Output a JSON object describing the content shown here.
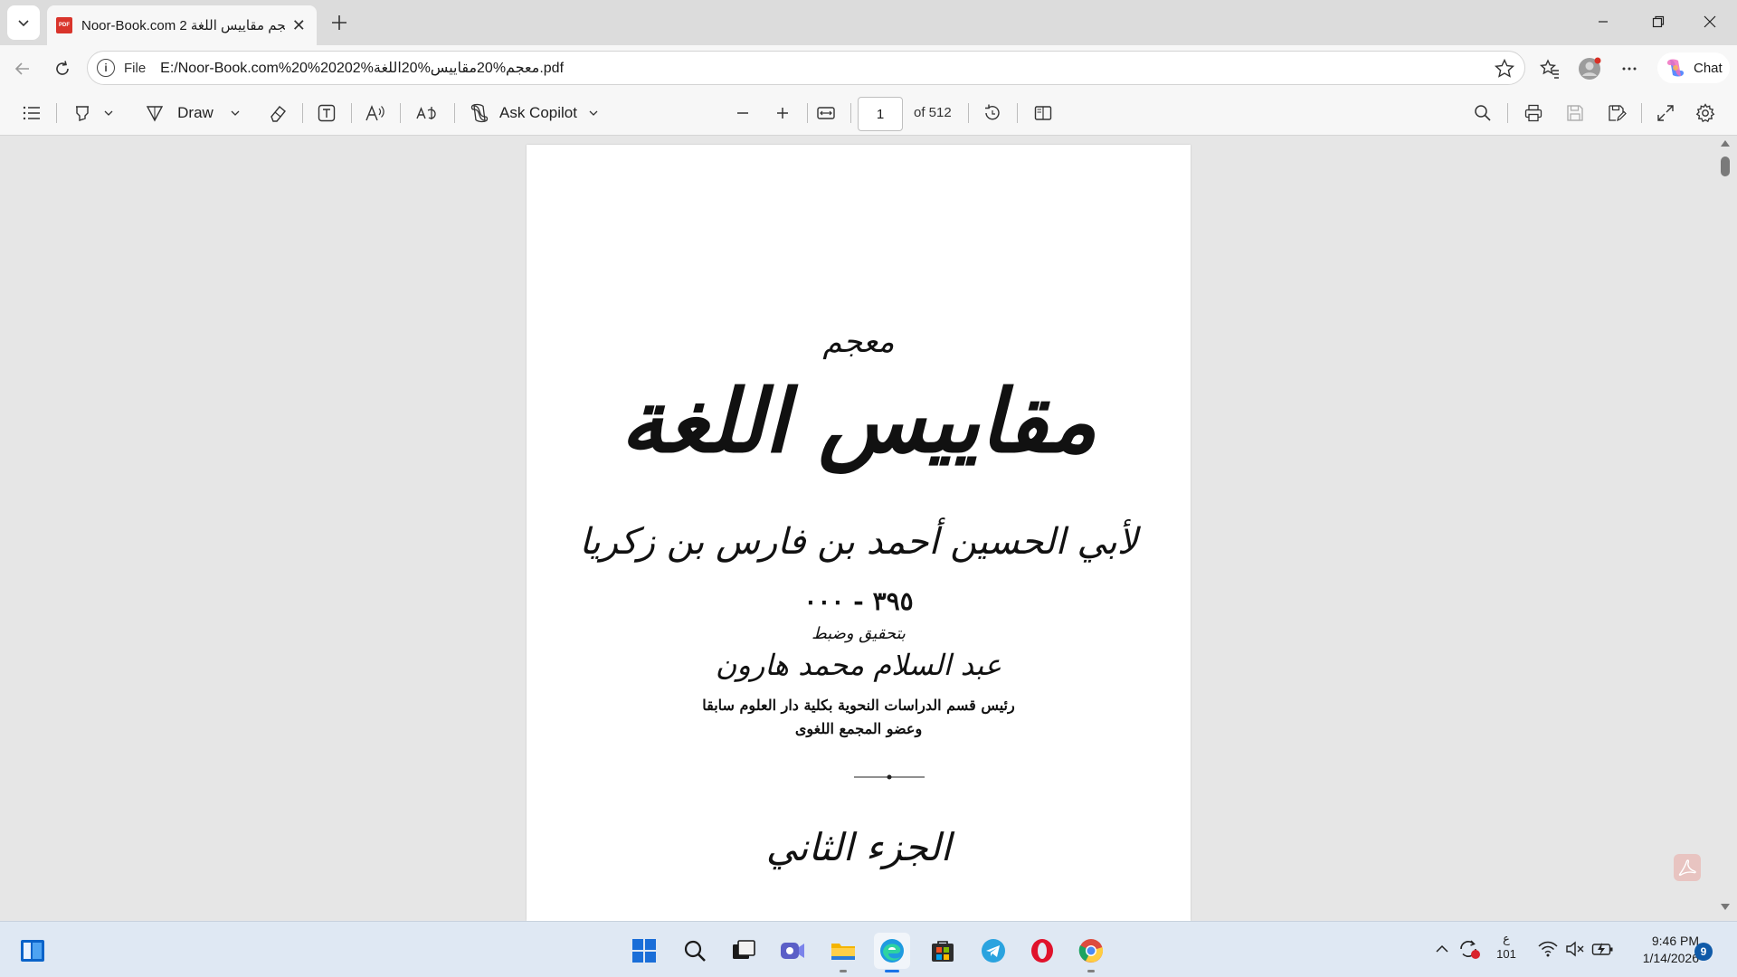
{
  "browser": {
    "tab": {
      "title": "Noor-Book.com معجم مقاييس اللغة 2",
      "favicon_text": "PDF"
    },
    "address": {
      "scheme_label": "File",
      "url": "E:/Noor-Book.com%20%20معجم%20مقاييس%20اللغة%202.pdf"
    },
    "chat_label": "Chat"
  },
  "pdf_toolbar": {
    "draw_label": "Draw",
    "ask_copilot_label": "Ask Copilot",
    "page_number": "1",
    "page_total_label": "of 512"
  },
  "document": {
    "mujam": "معجم",
    "title": "مقاييس اللغة",
    "author": "لأبي الحسين أحمد بن فارس بن زكريا",
    "dates": "٣٩٥ - ٠٠٠",
    "tahqiq": "بتحقيق وضبط",
    "editor": "عبد السلام محمد هارون",
    "role_line1": "رئيس قسم الدراسات النحوية بكلية دار العلوم سابقا",
    "role_line2": "وعضو المجمع اللغوى",
    "volume": "الجزء الثاني"
  },
  "taskbar": {
    "apps": [
      "start-icon",
      "search-icon",
      "task-view-icon",
      "teams-icon",
      "file-explorer-icon",
      "edge-icon",
      "store-icon",
      "telegram-icon",
      "opera-icon",
      "chrome-icon"
    ],
    "ime_line1": "ع",
    "ime_line2": "101",
    "time": "9:46 PM",
    "date": "1/14/2026",
    "notification_count": "9"
  },
  "colors": {
    "edge_active": "#1a73e8",
    "pdf_red": "#d9342b",
    "taskbar_bg": "#dfe8f3"
  }
}
